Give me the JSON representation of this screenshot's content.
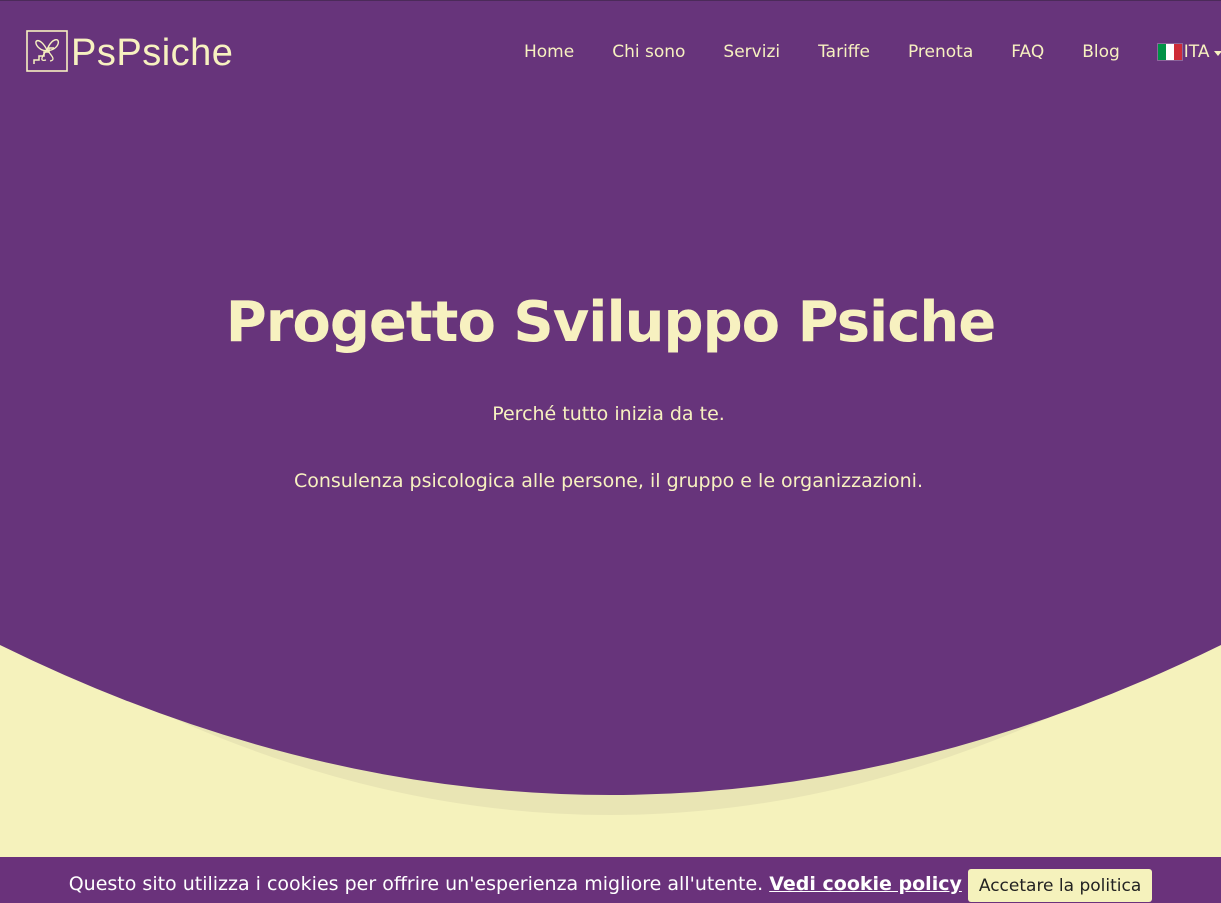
{
  "colors": {
    "primary_purple": "#67347b",
    "cream": "#f5f2bc",
    "cream_shadow": "#e9e5b4",
    "text_cream": "#f7f1c0"
  },
  "navbar": {
    "brand": "PsPsiche",
    "logo_icon": "butterfly-steps-logo",
    "items": [
      {
        "label": "Home"
      },
      {
        "label": "Chi sono"
      },
      {
        "label": "Servizi"
      },
      {
        "label": "Tariffe"
      },
      {
        "label": "Prenota"
      },
      {
        "label": "FAQ"
      },
      {
        "label": "Blog"
      }
    ],
    "language": {
      "label": "ITA",
      "flag_icon": "italy-flag-icon"
    }
  },
  "hero": {
    "title": "Progetto Sviluppo Psiche",
    "subtitle": "Perché tutto inizia da te.",
    "description": "Consulenza psicologica alle persone, il gruppo e le organizzazioni."
  },
  "cookie": {
    "text": "Questo sito utilizza i cookies per offrire un'esperienza migliore all'utente.",
    "link_label": "Vedi cookie policy",
    "button_label": "Accetare la politica"
  }
}
